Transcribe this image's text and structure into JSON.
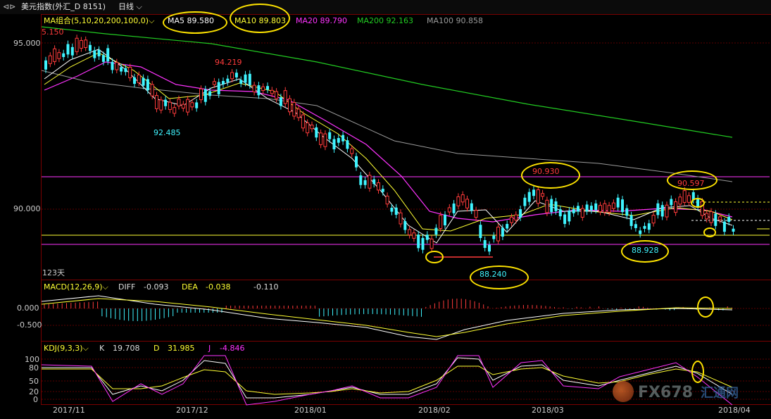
{
  "toolbar": {
    "nav_icon": "arrow-nav-icon",
    "title": "美元指数(外汇_D 8151)",
    "period": "日线"
  },
  "ma_legend": {
    "group": "MA组合(5,10,20,200,100,0)",
    "ma5": "MA5 89.580",
    "ma10": "MA10 89.803",
    "ma20": "MA20 89.790",
    "ma200": "MA200 92.163",
    "ma100": "MA100 90.858",
    "left_value": "5.150"
  },
  "price_axis": {
    "p95": "95.000",
    "p90": "90.000"
  },
  "price_annotations": {
    "high1": "94.219",
    "low1": "92.485",
    "high2": "90.930",
    "low2": "88.240",
    "high3": "90.597",
    "low3": "88.928",
    "bars_count": "123天"
  },
  "macd": {
    "label": "MACD(12,26,9)",
    "diff_label": "DIFF",
    "diff": "-0.093",
    "dea_label": "DEA",
    "dea": "-0.038",
    "macd": "-0.110",
    "axis_0": "0.000",
    "axis_m05": "-0.500"
  },
  "kdj": {
    "label": "KDJ(9,3,3)",
    "k_label": "K",
    "k": "19.708",
    "d_label": "D",
    "d": "31.985",
    "j_label": "J",
    "j": "-4.846",
    "axis": [
      "100",
      "80",
      "50",
      "20",
      "0"
    ]
  },
  "time_axis": [
    "2017/11",
    "2017/12",
    "2018/01",
    "2018/02",
    "2018/03",
    "2018/04"
  ],
  "watermark": {
    "brand": "FX678",
    "site": "汇通网"
  },
  "colors": {
    "up": "#ff3b3b",
    "down": "#3ff4ff",
    "ma5": "#ffffff",
    "ma10": "#ffff33",
    "ma20": "#ff33ff",
    "ma200": "#22cc22",
    "ma100": "#9a9a9a",
    "highlight": "#ffe400"
  }
}
